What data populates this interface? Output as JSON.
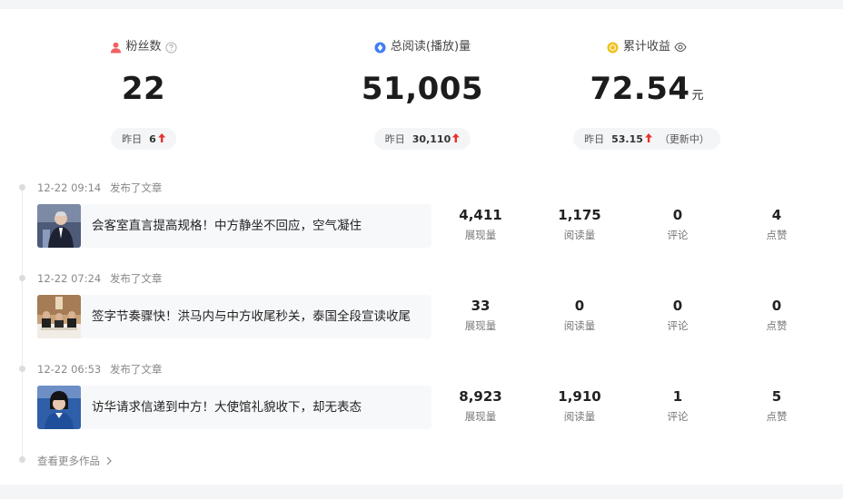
{
  "stats": [
    {
      "label": "粉丝数",
      "value": "22",
      "unit": "",
      "pill_prefix": "昨日",
      "pill_value": "6",
      "pill_extra": "",
      "color": "#f06262"
    },
    {
      "label": "总阅读(播放)量",
      "value": "51,005",
      "unit": "",
      "pill_prefix": "昨日",
      "pill_value": "30,110",
      "pill_extra": "",
      "color": "#3f7ef5"
    },
    {
      "label": "累计收益",
      "value": "72.54",
      "unit": "元",
      "pill_prefix": "昨日",
      "pill_value": "53.15",
      "pill_extra": "（更新中）",
      "color": "#f0c020"
    }
  ],
  "posts": [
    {
      "time": "12-22 09:14",
      "action": "发布了文章",
      "title": "会客室直言提高规格！中方静坐不回应，空气凝住",
      "metrics": [
        {
          "value": "4,411",
          "label": "展现量"
        },
        {
          "value": "1,175",
          "label": "阅读量"
        },
        {
          "value": "0",
          "label": "评论"
        },
        {
          "value": "4",
          "label": "点赞"
        }
      ]
    },
    {
      "time": "12-22 07:24",
      "action": "发布了文章",
      "title": "签字节奏骤快！洪马内与中方收尾秒关，泰国全段宣读收尾",
      "metrics": [
        {
          "value": "33",
          "label": "展现量"
        },
        {
          "value": "0",
          "label": "阅读量"
        },
        {
          "value": "0",
          "label": "评论"
        },
        {
          "value": "0",
          "label": "点赞"
        }
      ]
    },
    {
      "time": "12-22 06:53",
      "action": "发布了文章",
      "title": "访华请求信递到中方！大使馆礼貌收下，却无表态",
      "metrics": [
        {
          "value": "8,923",
          "label": "展现量"
        },
        {
          "value": "1,910",
          "label": "阅读量"
        },
        {
          "value": "1",
          "label": "评论"
        },
        {
          "value": "5",
          "label": "点赞"
        }
      ]
    }
  ],
  "more_label": "查看更多作品",
  "icons": {
    "fans": "person-icon",
    "reads": "diamond-icon",
    "earnings": "coin-icon",
    "help": "question-circle-icon",
    "eye": "eye-icon",
    "arrow": "arrow-up-icon",
    "chevron": "chevron-right-icon"
  }
}
